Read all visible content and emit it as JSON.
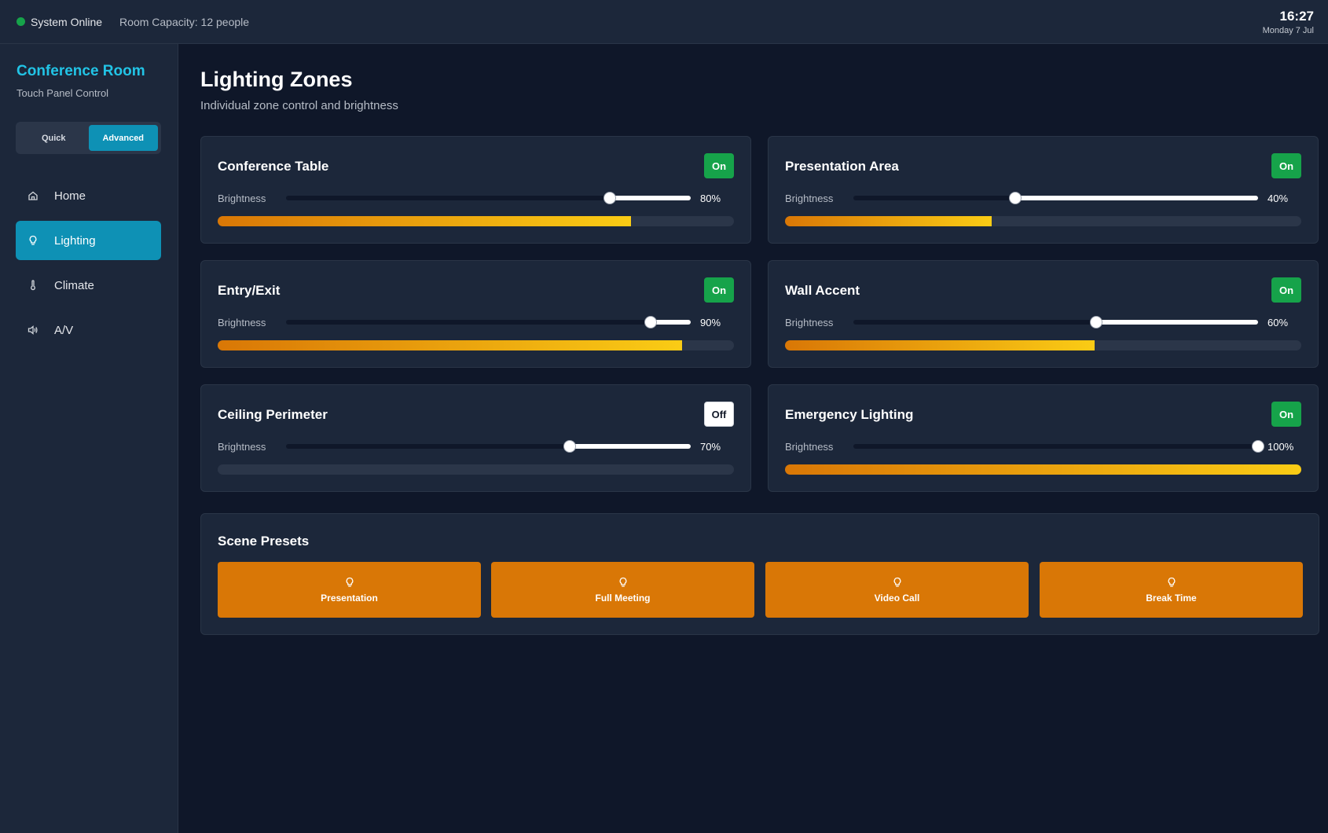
{
  "topbar": {
    "status": "System Online",
    "capacity": "Room Capacity: 12 people",
    "time": "16:27",
    "date": "Monday 7 Jul"
  },
  "sidebar": {
    "title": "Conference Room",
    "subtitle": "Touch Panel Control",
    "modes": [
      "Quick",
      "Advanced"
    ],
    "active_mode": "Advanced",
    "nav": [
      {
        "label": "Home",
        "icon": "home-icon"
      },
      {
        "label": "Lighting",
        "icon": "lightbulb-icon",
        "active": true
      },
      {
        "label": "Climate",
        "icon": "thermometer-icon"
      },
      {
        "label": "A/V",
        "icon": "speaker-icon"
      }
    ]
  },
  "main": {
    "title": "Lighting Zones",
    "subtitle": "Individual zone control and brightness",
    "brightness_label": "Brightness",
    "zones": [
      {
        "name": "Conference Table",
        "state": "On",
        "brightness": 80,
        "brightness_label": "80%"
      },
      {
        "name": "Presentation Area",
        "state": "On",
        "brightness": 40,
        "brightness_label": "40%"
      },
      {
        "name": "Entry/Exit",
        "state": "On",
        "brightness": 90,
        "brightness_label": "90%"
      },
      {
        "name": "Wall Accent",
        "state": "On",
        "brightness": 60,
        "brightness_label": "60%"
      },
      {
        "name": "Ceiling Perimeter",
        "state": "Off",
        "brightness": 70,
        "brightness_label": "70%"
      },
      {
        "name": "Emergency Lighting",
        "state": "On",
        "brightness": 100,
        "brightness_label": "100%"
      }
    ]
  },
  "presets": {
    "title": "Scene Presets",
    "items": [
      "Presentation",
      "Full Meeting",
      "Video Call",
      "Break Time"
    ]
  },
  "colors": {
    "accent": "#0e91b5",
    "brand": "#22c4e6",
    "on": "#16a34a",
    "preset": "#d97706",
    "level_gradient": [
      "#d97706",
      "#facc15"
    ]
  }
}
